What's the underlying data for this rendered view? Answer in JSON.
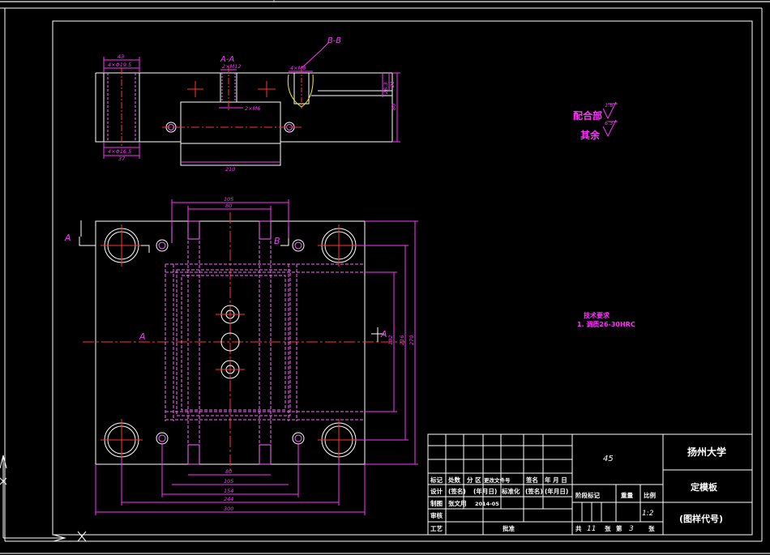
{
  "section_labels": {
    "aa_top": "A-A",
    "bb_top": "B-B",
    "a_left": "A",
    "a_center": "A",
    "a_right": "A",
    "b_mid": "B"
  },
  "top_view_dims": {
    "hole_w": "43",
    "hole_top": "4×Φ19.5",
    "hole_bot": "4×Φ16.5",
    "hole_bot_w": "37",
    "screw_aa": "2×M12",
    "screw_b": "2×M6",
    "bb_thread": "4×M8",
    "w210": "210",
    "h21": "21",
    "h26": "26.3",
    "h80": "80"
  },
  "plan_dims": {
    "top_105": "105",
    "top_80": "80",
    "bot_80": "80",
    "bot_105": "105",
    "bot_154": "154",
    "bot_244": "244",
    "bot_300": "300",
    "v_192": "192",
    "v_216": "216",
    "v_270": "270"
  },
  "notes": {
    "surface_fit": "配合部",
    "surface_fit_val": "1.6",
    "surface_rest": "其余",
    "surface_rest_val": "6.3",
    "tech_title": "技术要求",
    "tech_item": "1. 调质26-30HRC"
  },
  "title_block": {
    "material": "45",
    "university": "扬州大学",
    "part_name": "定模板",
    "drawing_code": "(图样代号)",
    "headers": [
      "标记",
      "处数",
      "分 区",
      "更改文件号",
      "签名",
      "年 月 日"
    ],
    "row_design": [
      "设计",
      "(签名)",
      "(年月日)",
      "标准化",
      "(签名)",
      "(年月日)"
    ],
    "row_draw": [
      "制图",
      "张文用",
      "2014-05"
    ],
    "row_check": "审核",
    "row_process": "工艺",
    "approve": "批准",
    "stage_label": "阶段标记",
    "weight_label": "重量",
    "scale_label": "比例",
    "scale_value": "1:2",
    "total_label": "共",
    "total_value": "11",
    "sheet_unit": "张",
    "sheet_label": "第",
    "sheet_value": "3",
    "sheet_unit2": "张"
  },
  "colors": {
    "background": "#000000",
    "outline": "#ffffff",
    "dimension": "#ff33ff",
    "centerline": "#ff3333",
    "hidden": "#ff66ff"
  }
}
